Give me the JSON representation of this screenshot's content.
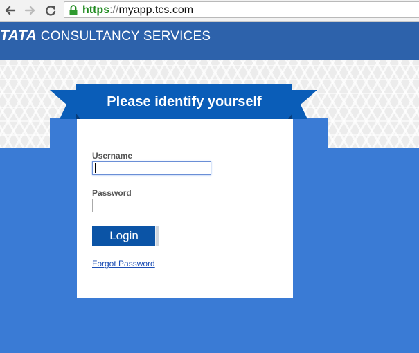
{
  "browser": {
    "url_protocol": "https",
    "url_separator": "://",
    "url_host": "myapp.tcs.com"
  },
  "header": {
    "brand_tata": "TATA",
    "brand_rest": " CONSULTANCY SERVICES"
  },
  "login": {
    "title": "Please identify yourself",
    "username_label": "Username",
    "username_value": "",
    "password_label": "Password",
    "password_value": "",
    "login_label": "Login",
    "forgot_label": "Forgot Password"
  },
  "colors": {
    "header_bg": "#2d62ab",
    "body_blue": "#3a7bd5",
    "banner_blue": "#0a5db8",
    "button_blue": "#0b54a6",
    "link_blue": "#1d4fb5",
    "secure_green": "#1f8a1f"
  },
  "icons": {
    "back": "arrow-left-icon",
    "forward": "arrow-right-icon",
    "reload": "reload-icon",
    "secure": "lock-icon"
  }
}
